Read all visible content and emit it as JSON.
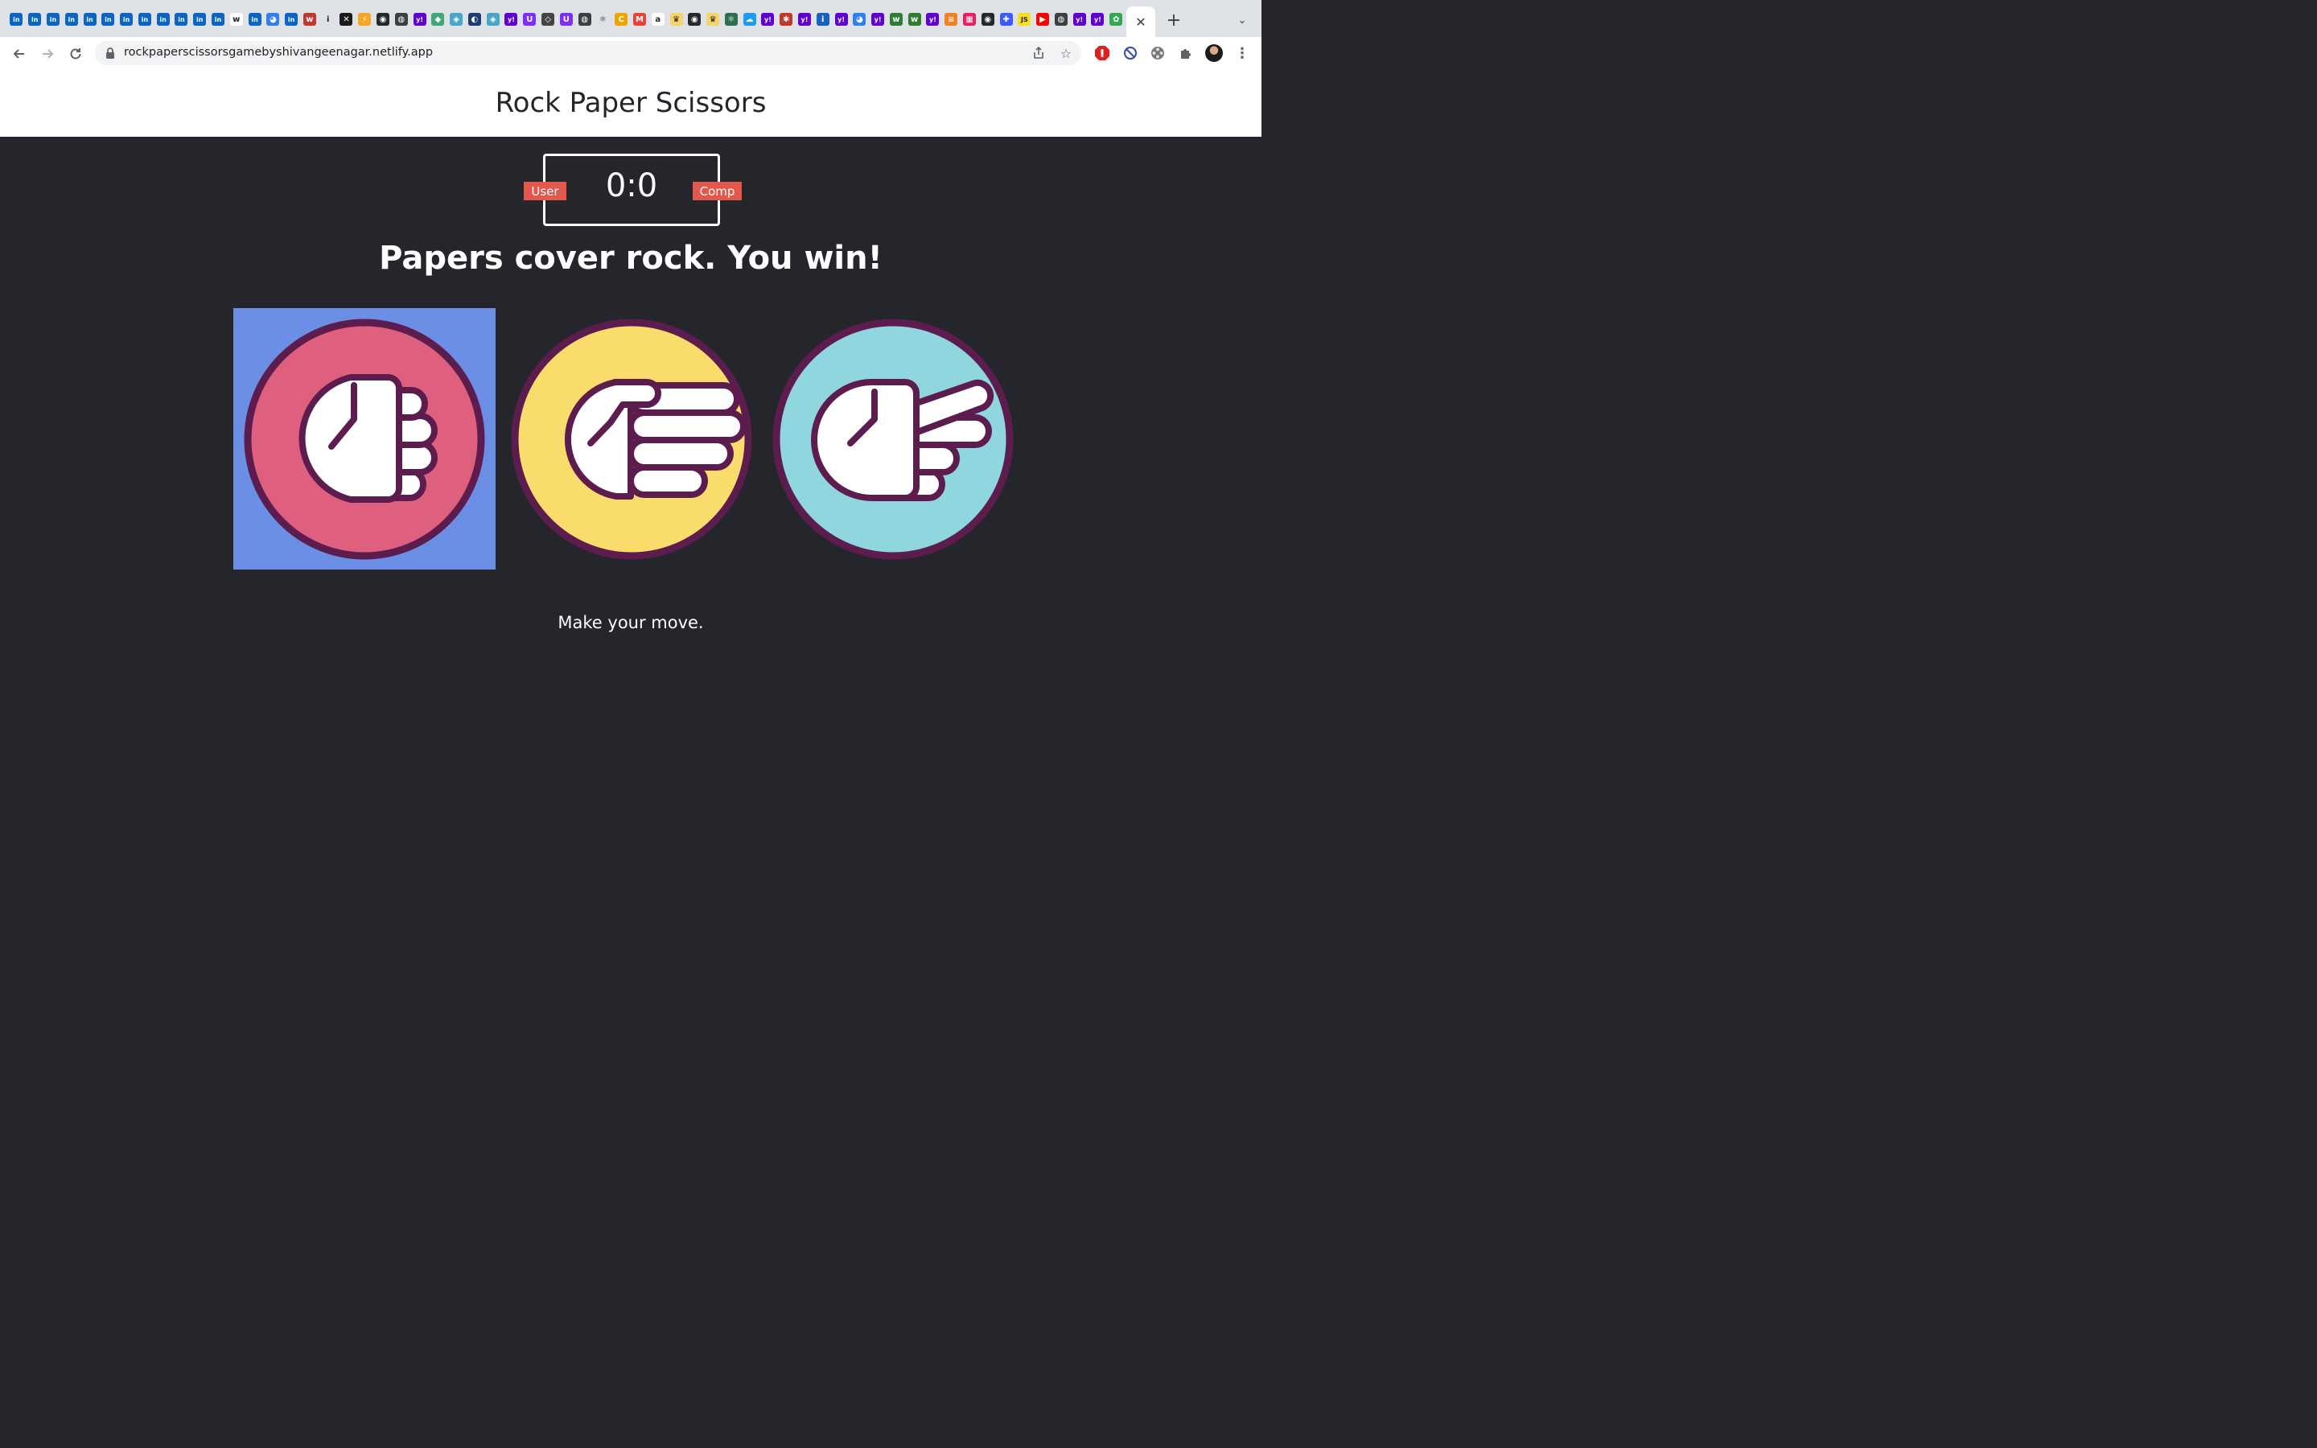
{
  "browser": {
    "url": "rockpaperscissorsgamebyshivangeenagar.netlify.app",
    "pinned_favicons": [
      {
        "icon": "linkedin-icon",
        "bg": "#0a66c2",
        "glyph": "in"
      },
      {
        "icon": "linkedin-icon",
        "bg": "#0a66c2",
        "glyph": "in"
      },
      {
        "icon": "linkedin-icon",
        "bg": "#0a66c2",
        "glyph": "in"
      },
      {
        "icon": "linkedin-icon",
        "bg": "#0a66c2",
        "glyph": "in"
      },
      {
        "icon": "linkedin-icon",
        "bg": "#0a66c2",
        "glyph": "in"
      },
      {
        "icon": "linkedin-icon",
        "bg": "#0a66c2",
        "glyph": "in"
      },
      {
        "icon": "linkedin-icon",
        "bg": "#0a66c2",
        "glyph": "in"
      },
      {
        "icon": "linkedin-icon",
        "bg": "#0a66c2",
        "glyph": "in"
      },
      {
        "icon": "linkedin-icon",
        "bg": "#0a66c2",
        "glyph": "in"
      },
      {
        "icon": "linkedin-icon",
        "bg": "#0a66c2",
        "glyph": "in"
      },
      {
        "icon": "linkedin-icon",
        "bg": "#0a66c2",
        "glyph": "in"
      },
      {
        "icon": "linkedin-icon",
        "bg": "#0a66c2",
        "glyph": "in"
      },
      {
        "icon": "w-icon",
        "bg": "#ffffff",
        "glyph": "w"
      },
      {
        "icon": "linkedin-icon",
        "bg": "#0a66c2",
        "glyph": "in"
      },
      {
        "icon": "github-icon",
        "bg": "#2f80ed",
        "glyph": "◕"
      },
      {
        "icon": "linkedin-icon",
        "bg": "#0a66c2",
        "glyph": "in"
      },
      {
        "icon": "wc-icon",
        "bg": "#c0392b",
        "glyph": "w"
      },
      {
        "icon": "info-icon",
        "bg": "#dee1e6",
        "glyph": "i"
      },
      {
        "icon": "x-icon",
        "bg": "#1a1a1a",
        "glyph": "✕"
      },
      {
        "icon": "bolt-icon",
        "bg": "#f5a623",
        "glyph": "⚡"
      },
      {
        "icon": "github-icon",
        "bg": "#24292e",
        "glyph": "◉"
      },
      {
        "icon": "globe-icon",
        "bg": "#3c4043",
        "glyph": "◍"
      },
      {
        "icon": "yahoo-icon",
        "bg": "#6001d2",
        "glyph": "y!"
      },
      {
        "icon": "diamond-icon",
        "bg": "#3ea87a",
        "glyph": "◆"
      },
      {
        "icon": "diamond-icon",
        "bg": "#48a6c9",
        "glyph": "◈"
      },
      {
        "icon": "shark-icon",
        "bg": "#1f3b73",
        "glyph": "◐"
      },
      {
        "icon": "diamond-icon",
        "bg": "#48a6c9",
        "glyph": "◈"
      },
      {
        "icon": "yahoo-icon",
        "bg": "#6001d2",
        "glyph": "y!"
      },
      {
        "icon": "u-icon",
        "bg": "#7b2ff7",
        "glyph": "U"
      },
      {
        "icon": "cube-icon",
        "bg": "#444444",
        "glyph": "◇"
      },
      {
        "icon": "u-icon",
        "bg": "#7b2ff7",
        "glyph": "U"
      },
      {
        "icon": "globe-icon",
        "bg": "#3c4043",
        "glyph": "◍"
      },
      {
        "icon": "react-icon",
        "bg": "#dee1e6",
        "glyph": "⚛"
      },
      {
        "icon": "c-icon",
        "bg": "#f0a500",
        "glyph": "C"
      },
      {
        "icon": "gmail-icon",
        "bg": "#ea4335",
        "glyph": "M"
      },
      {
        "icon": "amazon-icon",
        "bg": "#ffffff",
        "glyph": "a"
      },
      {
        "icon": "crown-icon",
        "bg": "#f5d46b",
        "glyph": "♛"
      },
      {
        "icon": "github-icon",
        "bg": "#24292e",
        "glyph": "◉"
      },
      {
        "icon": "crown-icon",
        "bg": "#f5d46b",
        "glyph": "♛"
      },
      {
        "icon": "react-icon",
        "bg": "#2b6e50",
        "glyph": "⚛"
      },
      {
        "icon": "cloud-icon",
        "bg": "#1d9bf0",
        "glyph": "☁"
      },
      {
        "icon": "yahoo-icon",
        "bg": "#6001d2",
        "glyph": "y!"
      },
      {
        "icon": "figure-icon",
        "bg": "#c0392b",
        "glyph": "✱"
      },
      {
        "icon": "yahoo-icon",
        "bg": "#6001d2",
        "glyph": "y!"
      },
      {
        "icon": "info-icon",
        "bg": "#1565c0",
        "glyph": "i"
      },
      {
        "icon": "yahoo-icon",
        "bg": "#6001d2",
        "glyph": "y!"
      },
      {
        "icon": "github-icon",
        "bg": "#2f80ed",
        "glyph": "◕"
      },
      {
        "icon": "yahoo-icon",
        "bg": "#6001d2",
        "glyph": "y!"
      },
      {
        "icon": "w-icon",
        "bg": "#2e7d32",
        "glyph": "w"
      },
      {
        "icon": "w-icon",
        "bg": "#2e7d32",
        "glyph": "w"
      },
      {
        "icon": "yahoo-icon",
        "bg": "#6001d2",
        "glyph": "y!"
      },
      {
        "icon": "stack-icon",
        "bg": "#f48024",
        "glyph": "≡"
      },
      {
        "icon": "blocks-icon",
        "bg": "#e91e63",
        "glyph": "▦"
      },
      {
        "icon": "github-icon",
        "bg": "#24292e",
        "glyph": "◉"
      },
      {
        "icon": "puzzle-icon",
        "bg": "#3d5afe",
        "glyph": "✚"
      },
      {
        "icon": "js-icon",
        "bg": "#f7df1e",
        "glyph": "JS"
      },
      {
        "icon": "youtube-icon",
        "bg": "#ff0000",
        "glyph": "▶"
      },
      {
        "icon": "globe-icon",
        "bg": "#3c4043",
        "glyph": "◍"
      },
      {
        "icon": "yahoo-icon",
        "bg": "#6001d2",
        "glyph": "y!"
      },
      {
        "icon": "yahoo-icon",
        "bg": "#6001d2",
        "glyph": "y!"
      },
      {
        "icon": "leaf-icon",
        "bg": "#34a853",
        "glyph": "✿"
      },
      {
        "icon": "diamond-icon",
        "bg": "#3ea87a",
        "glyph": "◆"
      }
    ],
    "active_tab_close": "✕",
    "new_tab": "+",
    "tab_search": "⌄"
  },
  "page": {
    "title": "Rock Paper Scissors",
    "score": "0:0",
    "user_label": "User",
    "comp_label": "Comp",
    "result": "Papers cover rock. You win!",
    "prompt": "Make your move."
  },
  "choices": [
    {
      "name": "rock",
      "icon": "rock-fist-icon",
      "color": "#de5f7e",
      "selected": true
    },
    {
      "name": "paper",
      "icon": "paper-hand-icon",
      "color": "#f9dc6c",
      "selected": false
    },
    {
      "name": "scissors",
      "icon": "scissors-hand-icon",
      "color": "#8fd6df",
      "selected": false
    }
  ],
  "colors": {
    "background": "#25262b",
    "header": "#ffffff",
    "badge": "#e2584d",
    "selected_highlight": "#6c8fe6",
    "outline": "#5c1d4e"
  }
}
